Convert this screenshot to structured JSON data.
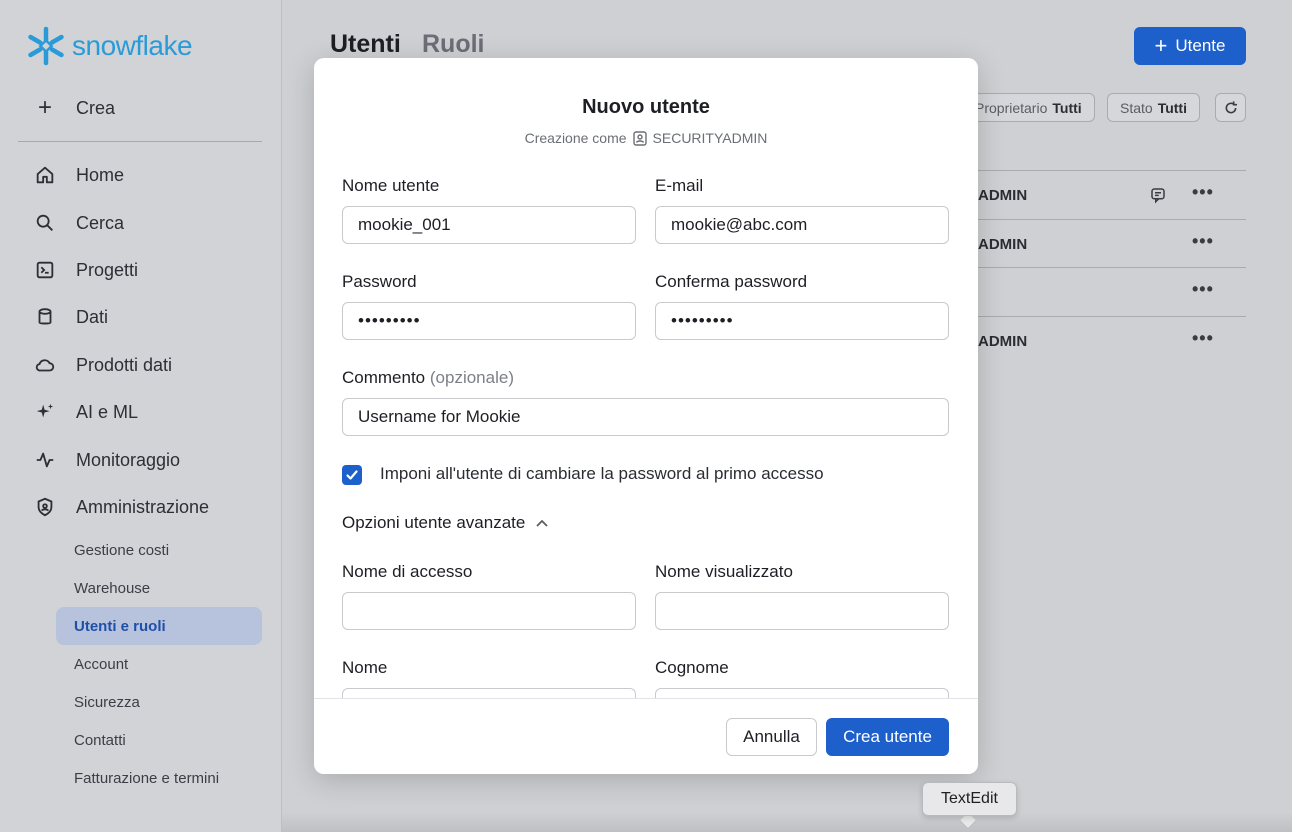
{
  "brand": {
    "name": "snowflake",
    "color": "#2a9bd8"
  },
  "sidebar": {
    "create_label": "Crea",
    "items": [
      {
        "label": "Home",
        "icon": "home-icon"
      },
      {
        "label": "Cerca",
        "icon": "search-icon"
      },
      {
        "label": "Progetti",
        "icon": "terminal-icon"
      },
      {
        "label": "Dati",
        "icon": "database-icon"
      },
      {
        "label": "Prodotti dati",
        "icon": "cloud-icon"
      },
      {
        "label": "AI e ML",
        "icon": "sparkle-icon"
      },
      {
        "label": "Monitoraggio",
        "icon": "activity-icon"
      },
      {
        "label": "Amministrazione",
        "icon": "shield-icon"
      }
    ],
    "subitems": [
      {
        "label": "Gestione costi"
      },
      {
        "label": "Warehouse"
      },
      {
        "label": "Utenti e ruoli",
        "active": true
      },
      {
        "label": "Account"
      },
      {
        "label": "Sicurezza"
      },
      {
        "label": "Contatti"
      },
      {
        "label": "Fatturazione e termini"
      }
    ]
  },
  "main": {
    "tab_users": "Utenti",
    "tab_roles": "Ruoli",
    "add_user_label": "Utente",
    "filters": [
      {
        "label": "Proprietario",
        "value": "Tutti"
      },
      {
        "label": "Stato",
        "value": "Tutti"
      }
    ],
    "rows": [
      "ADMIN",
      "ADMIN",
      "",
      "ADMIN"
    ]
  },
  "modal": {
    "title": "Nuovo utente",
    "subtitle_prefix": "Creazione come",
    "subtitle_role": "SECURITYADMIN",
    "fields": {
      "username": {
        "label": "Nome utente",
        "value": "mookie_001"
      },
      "email": {
        "label": "E-mail",
        "value": "mookie@abc.com"
      },
      "password": {
        "label": "Password",
        "value": "•••••••••"
      },
      "confirm_password": {
        "label": "Conferma password",
        "value": "•••••••••"
      },
      "comment": {
        "label": "Commento",
        "optional": "(opzionale)",
        "value": "Username for Mookie"
      },
      "login_name": {
        "label": "Nome di accesso",
        "value": ""
      },
      "display_name": {
        "label": "Nome visualizzato",
        "value": ""
      },
      "first_name": {
        "label": "Nome",
        "value": ""
      },
      "last_name": {
        "label": "Cognome",
        "value": ""
      }
    },
    "force_change_label": "Imponi all'utente di cambiare la password al primo accesso",
    "force_change_checked": true,
    "advanced_label": "Opzioni utente avanzate",
    "cancel_label": "Annulla",
    "create_label": "Crea utente"
  },
  "tooltip": {
    "text": "TextEdit"
  },
  "colors": {
    "accent": "#1d5fcb",
    "active_nav_bg": "#b7c3dc"
  }
}
